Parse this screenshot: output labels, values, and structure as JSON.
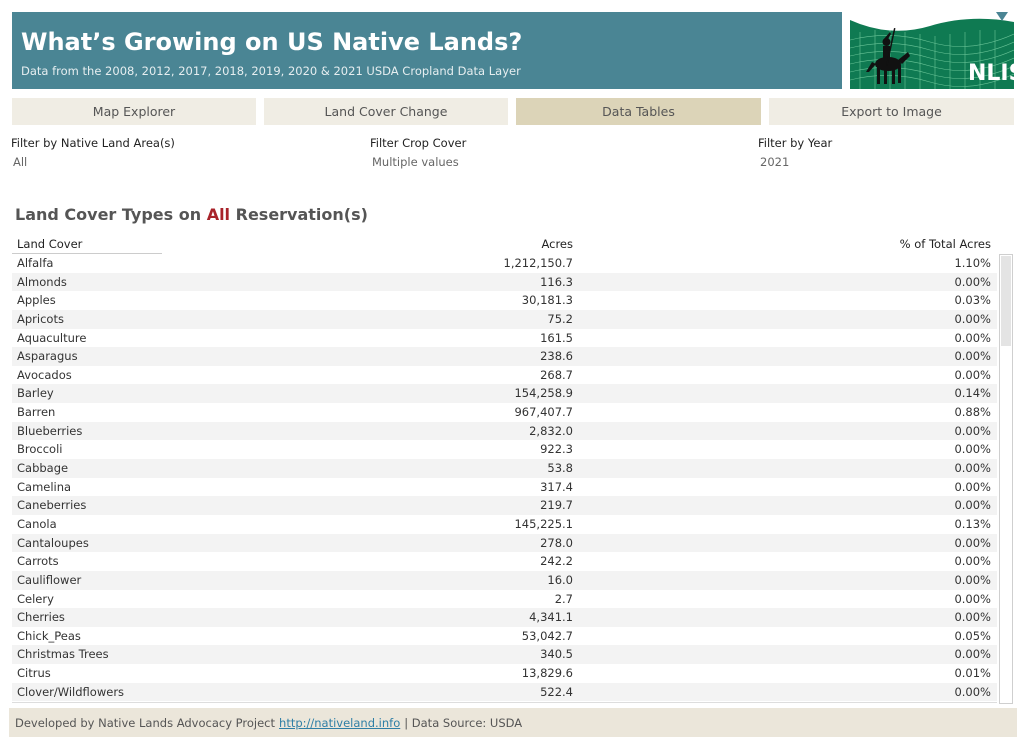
{
  "header": {
    "title": "What’s Growing on US Native Lands?",
    "subtitle": "Data from the 2008, 2012, 2017, 2018, 2019, 2020 & 2021 USDA Cropland Data Layer",
    "logo_text": "NLIS"
  },
  "tabs": [
    {
      "label": "Map Explorer",
      "active": false
    },
    {
      "label": "Land Cover Change",
      "active": false
    },
    {
      "label": "Data Tables",
      "active": true
    },
    {
      "label": "Export to Image",
      "active": false
    }
  ],
  "filters": {
    "native_land": {
      "label": "Filter by Native Land Area(s)",
      "value": "All"
    },
    "crop_cover": {
      "label": "Filter Crop Cover",
      "value": "Multiple values"
    },
    "year": {
      "label": "Filter by Year",
      "value": "2021"
    }
  },
  "section": {
    "title_prefix": "Land Cover Types on ",
    "title_highlight": "All",
    "title_suffix": " Reservation(s)"
  },
  "table": {
    "columns": [
      "Land Cover",
      "Acres",
      "% of Total Acres"
    ],
    "rows": [
      [
        "Alfalfa",
        "1,212,150.7",
        "1.10%"
      ],
      [
        "Almonds",
        "116.3",
        "0.00%"
      ],
      [
        "Apples",
        "30,181.3",
        "0.03%"
      ],
      [
        "Apricots",
        "75.2",
        "0.00%"
      ],
      [
        "Aquaculture",
        "161.5",
        "0.00%"
      ],
      [
        "Asparagus",
        "238.6",
        "0.00%"
      ],
      [
        "Avocados",
        "268.7",
        "0.00%"
      ],
      [
        "Barley",
        "154,258.9",
        "0.14%"
      ],
      [
        "Barren",
        "967,407.7",
        "0.88%"
      ],
      [
        "Blueberries",
        "2,832.0",
        "0.00%"
      ],
      [
        "Broccoli",
        "922.3",
        "0.00%"
      ],
      [
        "Cabbage",
        "53.8",
        "0.00%"
      ],
      [
        "Camelina",
        "317.4",
        "0.00%"
      ],
      [
        "Caneberries",
        "219.7",
        "0.00%"
      ],
      [
        "Canola",
        "145,225.1",
        "0.13%"
      ],
      [
        "Cantaloupes",
        "278.0",
        "0.00%"
      ],
      [
        "Carrots",
        "242.2",
        "0.00%"
      ],
      [
        "Cauliflower",
        "16.0",
        "0.00%"
      ],
      [
        "Celery",
        "2.7",
        "0.00%"
      ],
      [
        "Cherries",
        "4,341.1",
        "0.00%"
      ],
      [
        "Chick_Peas",
        "53,042.7",
        "0.05%"
      ],
      [
        "Christmas Trees",
        "340.5",
        "0.00%"
      ],
      [
        "Citrus",
        "13,829.6",
        "0.01%"
      ],
      [
        "Clover/Wildflowers",
        "522.4",
        "0.00%"
      ]
    ]
  },
  "footer": {
    "prefix": "Developed by Native Lands Advocacy Project",
    "link": "http://nativeland.info",
    "suffix": "| Data Source: USDA"
  },
  "colors": {
    "banner": "#4a8594",
    "active_tab": "#dcd4b8",
    "tab": "#f0ede4",
    "highlight": "#a8232a",
    "footer": "#ebe6da"
  }
}
